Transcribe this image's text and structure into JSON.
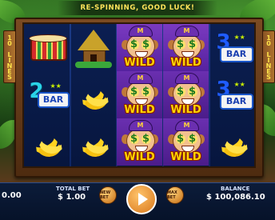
{
  "status": {
    "message": "RE-SPINNING, GOOD LUCK!"
  },
  "lines_sign": {
    "text": "10 LINES"
  },
  "reels": [
    [
      "drum-symbol",
      "2bar-symbol",
      "banana-symbol"
    ],
    [
      "hut-symbol",
      "banana-symbol",
      "banana-symbol"
    ],
    [
      "monkey-wild",
      "monkey-wild",
      "monkey-wild"
    ],
    [
      "monkey-wild",
      "monkey-wild",
      "monkey-wild"
    ],
    [
      "3bar-symbol",
      "3bar-symbol",
      "banana-symbol"
    ]
  ],
  "symbols": {
    "wild_label": "WILD",
    "wild_hat_letter": "M",
    "bar_text": "BAR",
    "two": "2",
    "three": "3",
    "stars": "★★"
  },
  "footer": {
    "win_value": "0.00",
    "total_bet_label": "TOTAL BET",
    "total_bet_value": "$ 1.00",
    "new_bet_label": "NEW BET",
    "max_bet_label": "MAX BET",
    "balance_label": "BALANCE",
    "balance_value": "$ 100,086.10"
  },
  "colors": {
    "highlight": "#6a2fb0",
    "wild_text": "#ffd400",
    "banner_text": "#ffe35a",
    "reel_background": "#0b1f52"
  }
}
